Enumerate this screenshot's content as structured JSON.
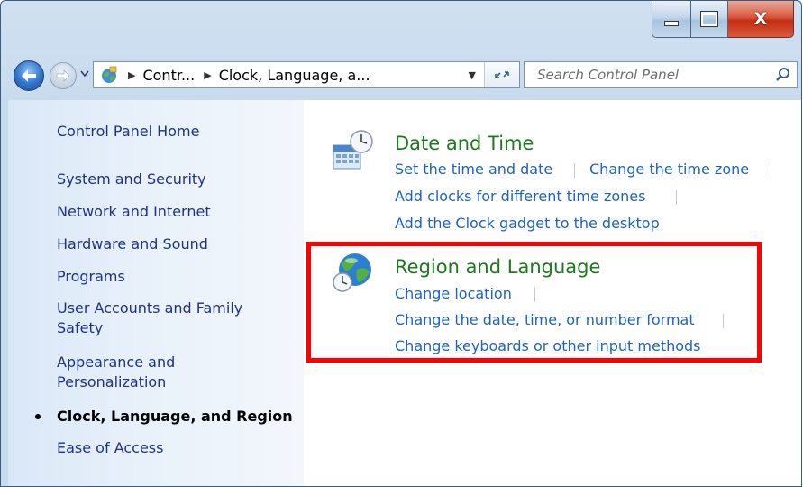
{
  "window": {
    "caption": {
      "minimize": "",
      "maximize": "",
      "close": "X"
    }
  },
  "address": {
    "crumbs": [
      "Contr...",
      "Clock, Language, a..."
    ],
    "search_placeholder": "Search Control Panel"
  },
  "sidebar": {
    "home": "Control Panel Home",
    "items": [
      "System and Security",
      "Network and Internet",
      "Hardware and Sound",
      "Programs",
      "User Accounts and Family Safety",
      "Appearance and Personalization",
      "Clock, Language, and Region",
      "Ease of Access"
    ],
    "current_index": 6
  },
  "categories": {
    "date_time": {
      "title": "Date and Time",
      "links": [
        "Set the time and date",
        "Change the time zone",
        "Add clocks for different time zones",
        "Add the Clock gadget to the desktop"
      ]
    },
    "region_language": {
      "title": "Region and Language",
      "links": [
        "Change location",
        "Change the date, time, or number format",
        "Change keyboards or other input methods"
      ]
    }
  },
  "colors": {
    "link": "#1c63c2",
    "category_title": "#1c7a1c",
    "nav_link": "#1e3287",
    "highlight": "#ff0000"
  },
  "icons": [
    "back-arrow-icon",
    "forward-arrow-icon",
    "control-panel-icon",
    "refresh-icon",
    "search-icon",
    "calendar-clock-icon",
    "globe-clock-icon"
  ]
}
